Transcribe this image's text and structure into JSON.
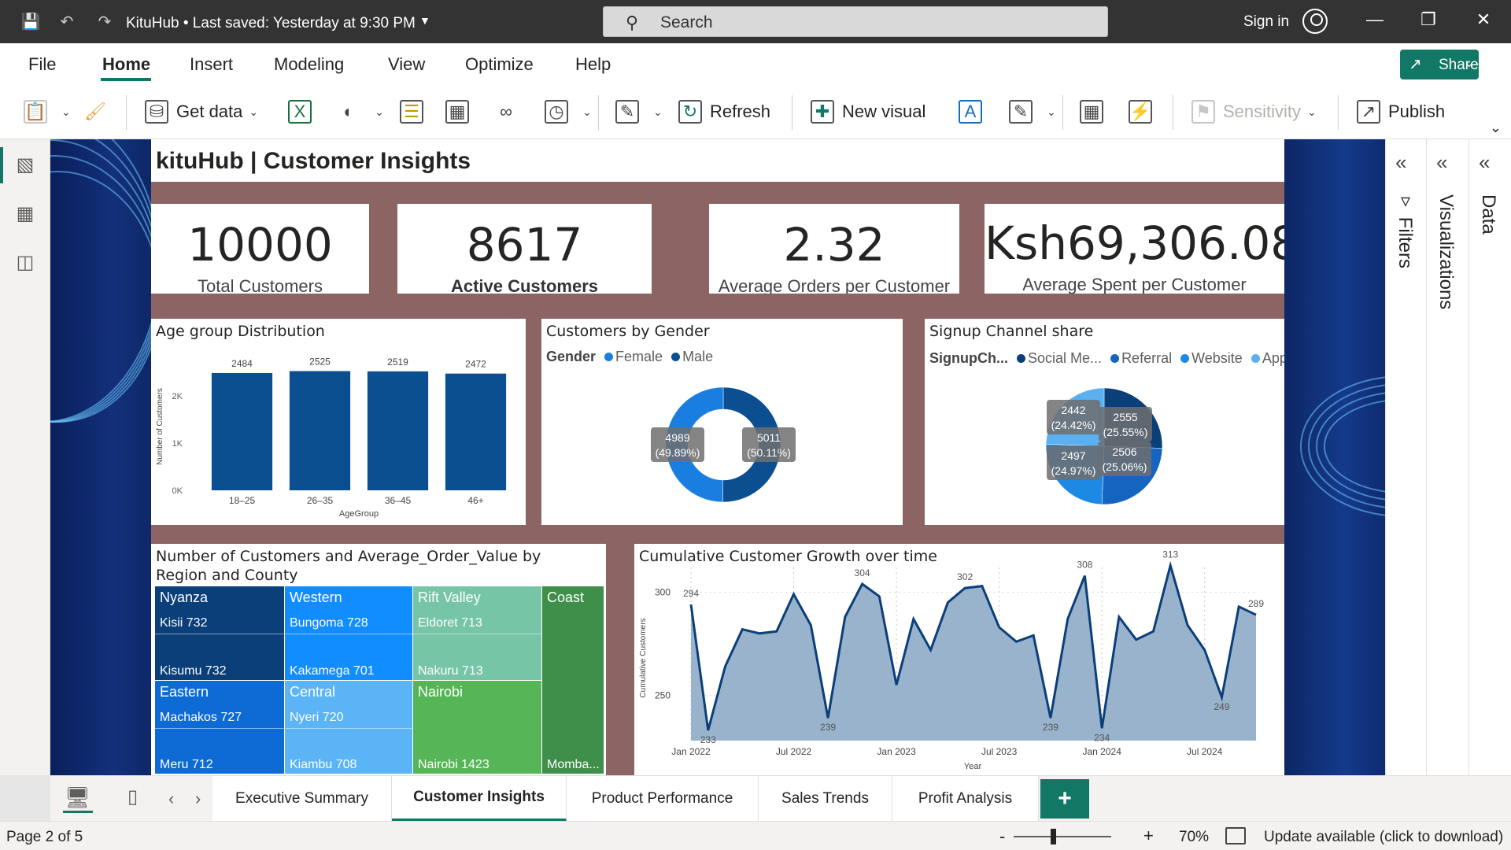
{
  "titlebar": {
    "app_title": "KituHub • Last saved: Yesterday at 9:30 PM",
    "search_placeholder": "Search",
    "signin_label": "Sign in",
    "icons": [
      "save-icon",
      "undo-icon",
      "redo-icon",
      "search-icon",
      "user-icon",
      "minimize-icon",
      "restore-icon",
      "close-icon"
    ]
  },
  "menu": {
    "items": [
      "File",
      "Home",
      "Insert",
      "Modeling",
      "View",
      "Optimize",
      "Help"
    ],
    "active": "Home",
    "share_label": "Share"
  },
  "ribbon": {
    "get_data": "Get data",
    "refresh": "Refresh",
    "new_visual": "New visual",
    "sensitivity": "Sensitivity",
    "publish": "Publish"
  },
  "report": {
    "title": "kituHub | Customer Insights",
    "kpis": [
      {
        "value": "10000",
        "label": "Total Customers"
      },
      {
        "value": "8617",
        "label": "Active Customers"
      },
      {
        "value": "2.32",
        "label": "Average Orders per Customer"
      },
      {
        "value": "Ksh69,306.08",
        "label": "Average Spent per Customer"
      }
    ]
  },
  "visuals": {
    "age": {
      "title": "Age group Distribution"
    },
    "gender": {
      "title": "Customers by Gender",
      "legend_title": "Gender",
      "legend": [
        "Female",
        "Male"
      ]
    },
    "signup": {
      "title": "Signup Channel share",
      "legend_title": "SignupCh...",
      "legend": [
        "Social Me...",
        "Referral",
        "Website",
        "App"
      ]
    },
    "treemap": {
      "title": "Number of Customers and Average_Order_Value by Region and County",
      "regions": [
        {
          "region": "Nyanza",
          "items": [
            "Kisii 732",
            "Kisumu 732"
          ]
        },
        {
          "region": "Western",
          "items": [
            "Bungoma 728",
            "Kakamega 701"
          ]
        },
        {
          "region": "Rift Valley",
          "items": [
            "Eldoret 713",
            "Nakuru 713"
          ]
        },
        {
          "region": "Coast",
          "items": [
            "Momba..."
          ]
        },
        {
          "region": "Eastern",
          "items": [
            "Machakos 727",
            "Meru 712"
          ]
        },
        {
          "region": "Central",
          "items": [
            "Nyeri 720",
            "Kiambu 708"
          ]
        },
        {
          "region": "Nairobi",
          "items": [
            "Nairobi 1423"
          ]
        }
      ]
    },
    "growth": {
      "title": "Cumulative Customer Growth over time"
    }
  },
  "chart_data": [
    {
      "type": "bar",
      "title": "Age group Distribution",
      "categories": [
        "18–25",
        "26–35",
        "36–45",
        "46+"
      ],
      "values": [
        2484,
        2525,
        2519,
        2472
      ],
      "data_labels": [
        "2484",
        "2525",
        "2519",
        "2472"
      ],
      "xlabel": "AgeGroup",
      "ylabel": "Number of Customers",
      "yticks": [
        "0K",
        "1K",
        "2K"
      ],
      "ylim": [
        0,
        2700
      ],
      "color": "#0b4f91"
    },
    {
      "type": "pie",
      "subtype": "donut",
      "title": "Customers by Gender",
      "labels": [
        "Male",
        "Female"
      ],
      "values": [
        5011,
        4989
      ],
      "data_labels": [
        [
          "5011",
          "(50.11%)"
        ],
        [
          "4989",
          "(49.89%)"
        ]
      ],
      "colors": [
        "#0b4f91",
        "#1a7ee0"
      ]
    },
    {
      "type": "pie",
      "title": "Signup Channel share",
      "labels": [
        "Social Media",
        "Referral",
        "Website",
        "App"
      ],
      "values": [
        2555,
        2506,
        2497,
        2442
      ],
      "data_labels": [
        [
          "2555",
          "(25.55%)"
        ],
        [
          "2506",
          "(25.06%)"
        ],
        [
          "2497",
          "(24.97%)"
        ],
        [
          "2442",
          "(24.42%)"
        ]
      ],
      "colors": [
        "#0b3f7a",
        "#1565c0",
        "#1e88e5",
        "#5ab0f0"
      ]
    },
    {
      "type": "area",
      "title": "Cumulative Customer Growth over time",
      "xlabel": "Year",
      "ylabel": "Cumulative Customers",
      "xticks": [
        "Jan 2022",
        "Jul 2022",
        "Jan 2023",
        "Jul 2023",
        "Jan 2024",
        "Jul 2024"
      ],
      "yticks": [
        "250",
        "300"
      ],
      "ylim": [
        228,
        312
      ],
      "values": [
        294,
        233,
        264,
        282,
        280,
        281,
        299,
        284,
        239,
        288,
        304,
        298,
        255,
        287,
        272,
        295,
        302,
        303,
        283,
        276,
        279,
        239,
        287,
        308,
        234,
        288,
        277,
        281,
        313,
        284,
        272,
        249,
        293,
        289
      ],
      "data_labels": [
        {
          "index": 0,
          "text": "294"
        },
        {
          "index": 1,
          "text": "233"
        },
        {
          "index": 8,
          "text": "239"
        },
        {
          "index": 10,
          "text": "304"
        },
        {
          "index": 16,
          "text": "302"
        },
        {
          "index": 21,
          "text": "239"
        },
        {
          "index": 23,
          "text": "308"
        },
        {
          "index": 24,
          "text": "234"
        },
        {
          "index": 28,
          "text": "313"
        },
        {
          "index": 31,
          "text": "249"
        },
        {
          "index": 33,
          "text": "289"
        }
      ],
      "line_color": "#0b3f7a",
      "fill_color": "#99b3cc"
    }
  ],
  "tabs": {
    "pages": [
      "Executive Summary",
      "Customer Insights",
      "Product Performance",
      "Sales Trends",
      "Profit Analysis"
    ],
    "active": "Customer Insights",
    "add_label": "+"
  },
  "panes": {
    "filters": "Filters",
    "visualizations": "Visualizations",
    "data": "Data"
  },
  "status": {
    "page_info": "Page 2 of 5",
    "zoom_minus": "-",
    "zoom_plus": "+",
    "zoom": "70%",
    "zoom_level_fraction": 0.4,
    "update": "Update available (click to download)"
  }
}
